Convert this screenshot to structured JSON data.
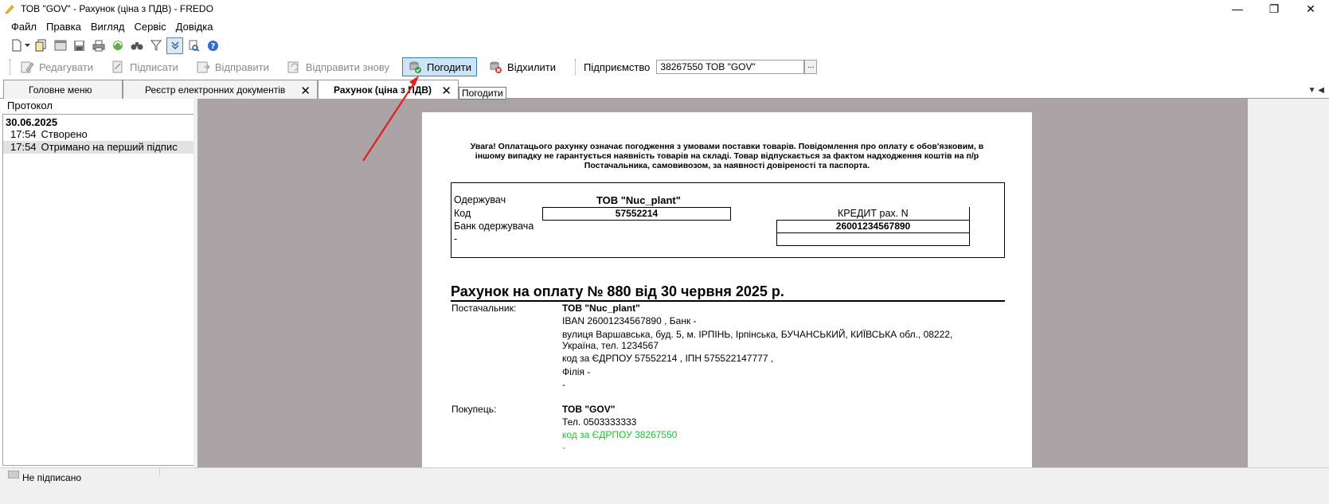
{
  "window": {
    "title": "ТОВ \"GOV\" - Рахунок (ціна з ПДВ) - FREDO",
    "minimize": "—",
    "maximize": "❐",
    "close": "✕"
  },
  "menu": [
    "Файл",
    "Правка",
    "Вигляд",
    "Сервіс",
    "Довідка"
  ],
  "iconbar": [
    "new-icon",
    "dropdown-icon",
    "copy-icon",
    "window-icon",
    "save-icon",
    "print-icon",
    "refresh-icon",
    "search-icon",
    "filter-icon",
    "expand-icon",
    "find-icon",
    "help-icon"
  ],
  "actions": {
    "edit": "Редагувати",
    "sign": "Підписати",
    "send": "Відправити",
    "resend": "Відправити знову",
    "approve": "Погодити",
    "reject": "Відхилити",
    "enterprise_label": "Підприємство",
    "enterprise_value": "38267550  ТОВ \"GOV\"",
    "enterprise_btn": "..."
  },
  "tabs": [
    {
      "label": "Головне меню"
    },
    {
      "label": "Реєстр електронних документів"
    },
    {
      "label": "Рахунок (ціна з ПДВ)"
    }
  ],
  "tooltip": "Погодити",
  "protocol": {
    "title": "Протокол",
    "date": "30.06.2025",
    "entries": [
      {
        "time": "17:54",
        "text": "Створено"
      },
      {
        "time": "17:54",
        "text": "Отримано на перший підпис"
      }
    ]
  },
  "document": {
    "warning": "Увага! Оплатацього рахунку означає погодження з умовами поставки товарів. Повідомлення про оплату є обов'язковим, в іншому випадку не гарантується наявність товарів на складі. Товар відпускається за фактом надходження коштів на п/р Постачальника, самовивозом, за наявності довіреності та паспорта.",
    "recipient_label": "Одержувач",
    "recipient_name": "ТОВ \"Nuc_plant\"",
    "code_label": "Код",
    "code_value": "57552214",
    "credit_label": "КРЕДИТ рах. N",
    "account": "26001234567890",
    "bank_label": "Банк одержувача",
    "bank_value": "-",
    "invoice_title": "Рахунок на оплату № 880 від 30 червня 2025 р.",
    "supplier_label": "Постачальник:",
    "supplier_name": "ТОВ \"Nuc_plant\"",
    "supplier_iban": "IBAN 26001234567890  , Банк -",
    "supplier_address_1": "вулиця Варшавська, буд. 5, м. ІРПІНЬ, Ірпінська, БУЧАНСЬКИЙ, КИЇВСЬКА обл., 08222,",
    "supplier_address_2": "Україна, тел. 1234567",
    "supplier_codes": "код за ЄДРПОУ 57552214 , ІПН 575522147777 ,",
    "supplier_branch": "Філія -",
    "supplier_dash": "-",
    "buyer_label": "Покупець:",
    "buyer_name": "ТОВ \"GOV\"",
    "buyer_phone": "Тел. 0503333333",
    "buyer_code": "код за ЄДРПОУ 38267550",
    "buyer_dash": "-"
  },
  "status": {
    "text": "Не підписано"
  },
  "colors": {
    "doc_bg": "#aba3a6",
    "highlight_btn": "#cde3f7",
    "green_text": "#22c030",
    "arrow": "#e02020"
  }
}
